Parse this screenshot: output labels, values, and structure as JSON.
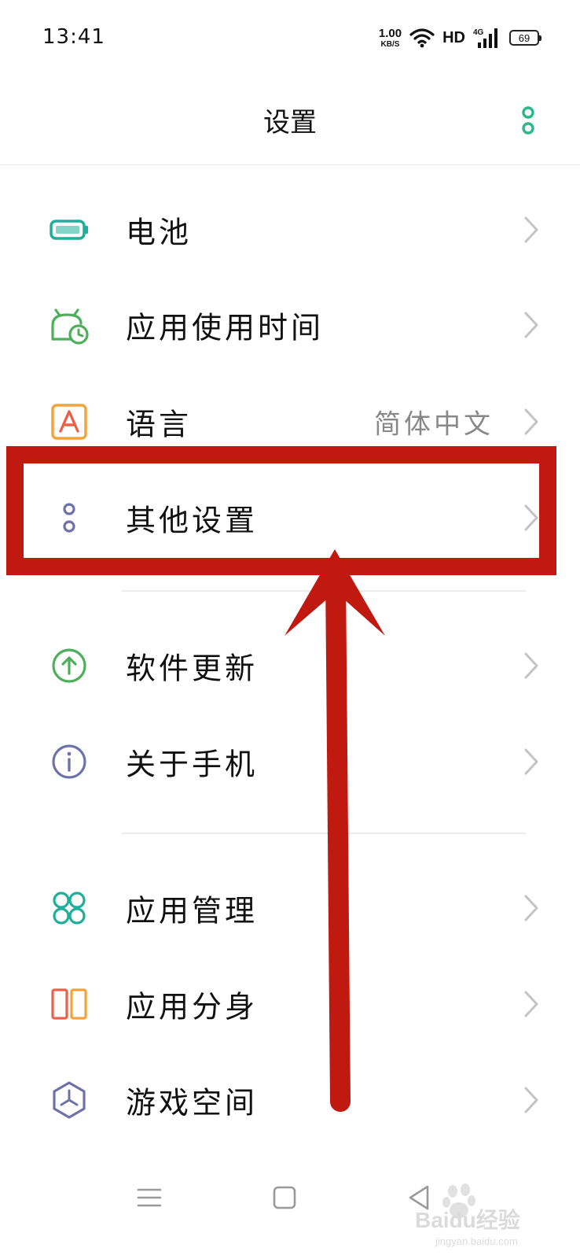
{
  "status_bar": {
    "time": "13:41",
    "net_speed_value": "1.00",
    "net_speed_unit": "KB/S",
    "hd": "HD",
    "network": "4G",
    "battery": "69"
  },
  "header": {
    "title": "设置",
    "more_icon": "more-vertical-icon"
  },
  "settings_items": [
    {
      "label": "电池",
      "value": "",
      "icon": "battery-icon",
      "color": "#1fae9a"
    },
    {
      "label": "应用使用时间",
      "value": "",
      "icon": "app-usage-clock-icon",
      "color": "#4cb05a"
    },
    {
      "label": "语言",
      "value": "简体中文",
      "icon": "language-icon",
      "color": "#f2a33a"
    },
    {
      "label": "其他设置",
      "value": "",
      "icon": "other-settings-icon",
      "color": "#6e72a8"
    },
    {
      "label": "软件更新",
      "value": "",
      "icon": "software-update-icon",
      "color": "#4cb05a"
    },
    {
      "label": "关于手机",
      "value": "",
      "icon": "info-icon",
      "color": "#6e72a8"
    },
    {
      "label": "应用管理",
      "value": "",
      "icon": "app-management-icon",
      "color": "#1fae9a"
    },
    {
      "label": "应用分身",
      "value": "",
      "icon": "app-clone-icon",
      "color": "#e8793a"
    },
    {
      "label": "游戏空间",
      "value": "",
      "icon": "game-space-icon",
      "color": "#6e72a8"
    }
  ],
  "annotation": {
    "color": "#c01a10",
    "target": "其他设置"
  },
  "nav_bar": {
    "menu_icon": "menu-icon",
    "home_icon": "home-icon",
    "back_icon": "back-icon"
  },
  "watermark": {
    "brand": "Baidu经验",
    "sub": "jingyan.baidu.com"
  }
}
